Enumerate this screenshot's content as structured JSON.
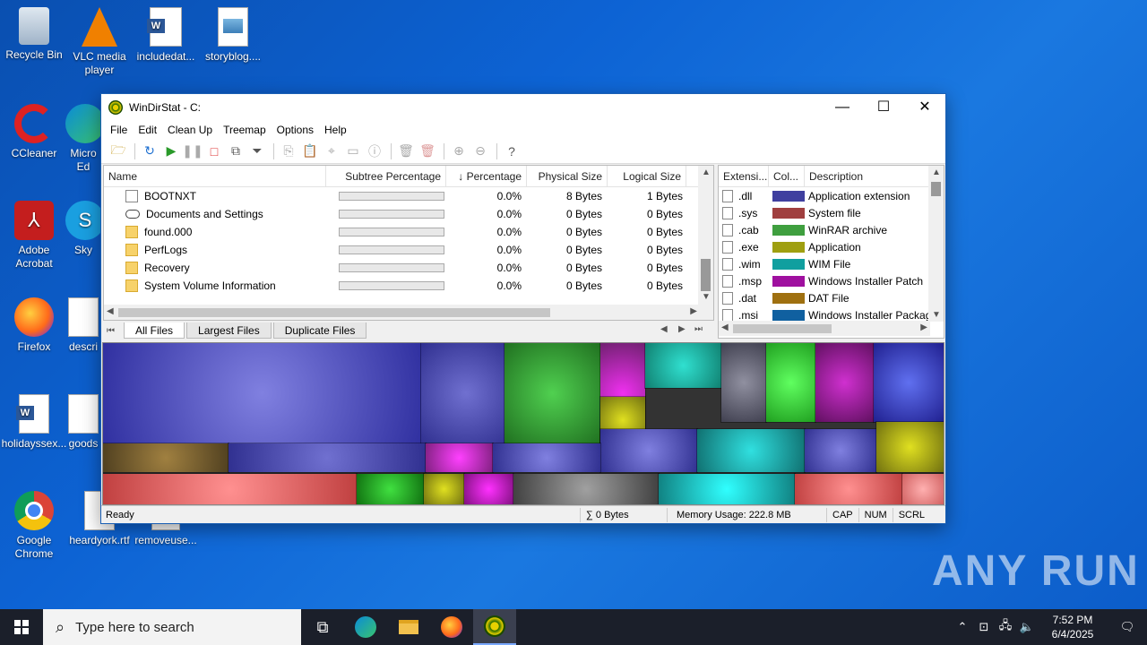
{
  "desktop": {
    "icons": [
      {
        "label": "Recycle Bin",
        "icon": "recycle-bin-icon"
      },
      {
        "label": "VLC media player",
        "icon": "vlc-icon"
      },
      {
        "label": "includedat...",
        "icon": "word-doc-icon"
      },
      {
        "label": "storyblog....",
        "icon": "image-file-icon"
      },
      {
        "label": "CCleaner",
        "icon": "ccleaner-icon"
      },
      {
        "label": "Micro Ed",
        "icon": "edge-icon"
      },
      {
        "label": "Adobe Acrobat",
        "icon": "acrobat-icon"
      },
      {
        "label": "Sky",
        "icon": "skype-icon"
      },
      {
        "label": "Firefox",
        "icon": "firefox-icon"
      },
      {
        "label": "descri",
        "icon": "word-doc-icon"
      },
      {
        "label": "holidayssex...",
        "icon": "word-doc-icon"
      },
      {
        "label": "goods",
        "icon": "image-file-icon"
      },
      {
        "label": "Google Chrome",
        "icon": "chrome-icon"
      },
      {
        "label": "heardyork.rtf",
        "icon": "word-doc-icon"
      },
      {
        "label": "removeuse...",
        "icon": "blank-file-icon"
      }
    ],
    "watermark": "ANY RUN"
  },
  "window": {
    "title": "WinDirStat - C:",
    "controls": {
      "minimize": "—",
      "maximize": "☐",
      "close": "✕"
    },
    "menu": [
      "File",
      "Edit",
      "Clean Up",
      "Treemap",
      "Options",
      "Help"
    ]
  },
  "tree": {
    "columns": [
      "Name",
      "Subtree Percentage",
      "↓ Percentage",
      "Physical Size",
      "Logical Size"
    ],
    "rows": [
      {
        "name": "BOOTNXT",
        "icon": "file",
        "percentage": "0.0%",
        "physical": "8 Bytes",
        "logical": "1 Bytes"
      },
      {
        "name": "Documents and Settings",
        "icon": "link",
        "percentage": "0.0%",
        "physical": "0 Bytes",
        "logical": "0 Bytes"
      },
      {
        "name": "found.000",
        "icon": "folder",
        "percentage": "0.0%",
        "physical": "0 Bytes",
        "logical": "0 Bytes"
      },
      {
        "name": "PerfLogs",
        "icon": "folder",
        "percentage": "0.0%",
        "physical": "0 Bytes",
        "logical": "0 Bytes"
      },
      {
        "name": "Recovery",
        "icon": "folder",
        "percentage": "0.0%",
        "physical": "0 Bytes",
        "logical": "0 Bytes"
      },
      {
        "name": "System Volume Information",
        "icon": "folder",
        "percentage": "0.0%",
        "physical": "0 Bytes",
        "logical": "0 Bytes"
      }
    ]
  },
  "tabs": [
    "All Files",
    "Largest Files",
    "Duplicate Files"
  ],
  "extensions": {
    "columns": [
      "Extensi...",
      "Col...",
      "Description"
    ],
    "rows": [
      {
        "ext": ".dll",
        "color": "#3f3f9f",
        "desc": "Application extension"
      },
      {
        "ext": ".sys",
        "color": "#a03f3f",
        "desc": "System file"
      },
      {
        "ext": ".cab",
        "color": "#3f9f3f",
        "desc": "WinRAR archive"
      },
      {
        "ext": ".exe",
        "color": "#9f9f10",
        "desc": "Application"
      },
      {
        "ext": ".wim",
        "color": "#109f9f",
        "desc": "WIM File"
      },
      {
        "ext": ".msp",
        "color": "#9f109f",
        "desc": "Windows Installer Patch"
      },
      {
        "ext": ".dat",
        "color": "#9f7010",
        "desc": "DAT File"
      },
      {
        "ext": ".msi",
        "color": "#1060a0",
        "desc": "Windows Installer Packag"
      }
    ]
  },
  "status": {
    "ready": "Ready",
    "sum": "∑ 0 Bytes",
    "memory": "Memory Usage: 222.8 MB",
    "cap": "CAP",
    "num": "NUM",
    "scrl": "SCRL"
  },
  "taskbar": {
    "search_placeholder": "Type here to search",
    "time": "7:52 PM",
    "date": "6/4/2025"
  }
}
